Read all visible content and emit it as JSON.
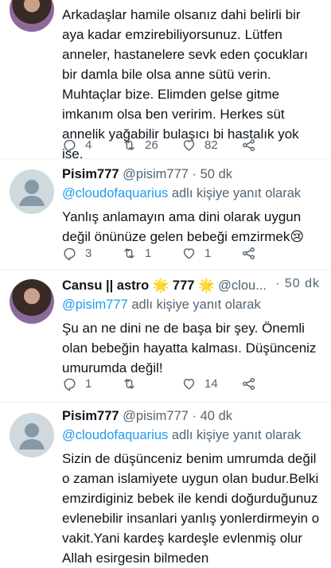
{
  "tweets": [
    {
      "text": "Arkadaşlar hamile olsanız dahi belirli bir aya kadar emzirebiliyorsunuz. Lütfen anneler, hastanelere sevk eden çocukları bir damla bile olsa anne sütü verin. Muhtaçlar bize. Elimden gelse gitme imkanım olsa ben veririm. Herkes süt annelik yağabilir bulaşıcı bi hastalık yok ise.",
      "replies": "4",
      "retweets": "26",
      "likes": "82"
    },
    {
      "name": "Pisim777",
      "handle": "@pisim777",
      "time": "· 50 dk",
      "reply_to": "@cloudofaquarius",
      "reply_suffix": " adlı kişiye yanıt olarak",
      "text": "Yanlış anlamayın ama dini olarak uygun değil önünüze gelen bebeği emzirmek😢",
      "replies": "3",
      "retweets": "1",
      "likes": "1"
    },
    {
      "name": "Cansu || astro",
      "star1": "🌟",
      "num": " 777 ",
      "star2": "🌟",
      "handle": "@clou...",
      "time": "· 50 dk",
      "reply_to": "@pisim777",
      "reply_suffix": " adlı kişiye yanıt olarak",
      "text": "Şu an ne dini ne de başa  bir şey. Önemli olan bebeğin hayatta kalması. Düşünceniz umurumda değil!",
      "replies": "1",
      "retweets": "",
      "likes": "14"
    },
    {
      "name": "Pisim777",
      "handle": "@pisim777",
      "time": "· 40 dk",
      "reply_to": "@cloudofaquarius",
      "reply_suffix": " adlı kişiye yanıt olarak",
      "text": "Sizin de düşünceniz benim umrumda değil o zaman islamiyete uygun olan budur.Belki emzirdiginiz bebek ile kendi doğurduğunuz evlenebilir insanlari yanlış yonlerdirmeyin o vakit.Yani kardeş kardeşle evlenmiş olur Allah esirgesin bilmeden"
    }
  ]
}
